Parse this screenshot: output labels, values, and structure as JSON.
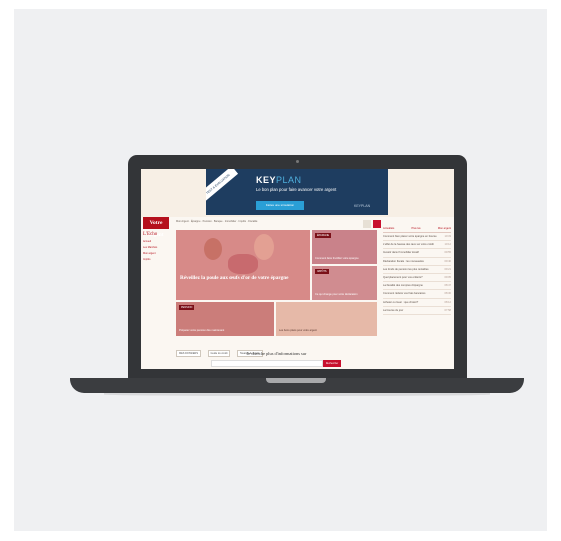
{
  "ad": {
    "ribbon": "TEST & EVALUATION",
    "brand_a": "KEY",
    "brand_b": "PLAN",
    "tagline": "Le bon plan pour faire avancer votre argent",
    "cta": "Faites une simulation",
    "logo": "KEYPLAN"
  },
  "site": {
    "logo": "Votre argent",
    "section": "L'Echo",
    "nav": [
      "Accueil",
      "Les Marchés",
      "Mon argent",
      "Impôts"
    ],
    "topbar": "Mon Argent · Épargne · Pension · Banque · Immobilier · Impôts · Fiscalité",
    "hero": "Réveillez la poule aux œufs d'or de votre épargne",
    "tiles": [
      {
        "tag": "ÉPARGNE",
        "text": "Comment faire fructifier votre épargne"
      },
      {
        "tag": "IMPÔTS",
        "text": "Ce qui change pour votre déclaration"
      },
      {
        "tag": "PENSION",
        "text": "Préparez votre pension dès maintenant"
      },
      {
        "tag": "",
        "text": "Les bons plans pour votre argent"
      }
    ],
    "chips": [
      "MES DOSSIERS",
      "Guide du crédit",
      "Taxation & impôts"
    ],
    "promo": "Je cherche plus d'informations sur",
    "promo_button": "Rechercher",
    "right_tabs": [
      "Actualités",
      "Plus lus",
      "Mon argent"
    ],
    "right_items": [
      {
        "text": "Comment bien placer votre épargne en bourse",
        "time": "10:33"
      },
      {
        "text": "L'effet de la hausse des taux sur votre crédit",
        "time": "10:12"
      },
      {
        "text": "Investir dans l'immobilier locatif",
        "time": "09:55"
      },
      {
        "text": "Déclaration fiscale : les nouveautés",
        "time": "09:40"
      },
      {
        "text": "Les fonds de pension les plus rentables",
        "time": "09:21"
      },
      {
        "text": "Quel placement pour vos enfants?",
        "time": "09:05"
      },
      {
        "text": "La fiscalité des comptes d'épargne",
        "time": "08:47"
      },
      {
        "text": "Comment réduire vos frais bancaires",
        "time": "08:30"
      },
      {
        "text": "Acheter ou louer : que choisir?",
        "time": "08:12"
      },
      {
        "text": "La bourse du jour",
        "time": "07:58"
      }
    ]
  }
}
